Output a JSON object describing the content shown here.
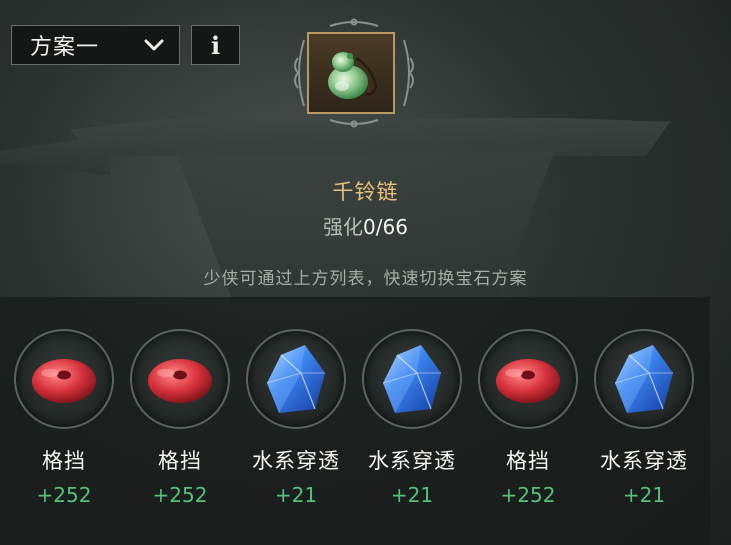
{
  "plan_selector": {
    "label": "方案一",
    "icon": "chevron-down-icon"
  },
  "info_button": {
    "label": "i",
    "icon": "info-icon"
  },
  "item": {
    "icon": "jade-pendant-icon",
    "name": "千铃链",
    "enhance_label": "强化",
    "enhance_value": "0/66"
  },
  "hint": "少侠可通过上方列表，快速切换宝石方案",
  "gems": [
    {
      "type": "red-disc",
      "name": "格挡",
      "value": "+252"
    },
    {
      "type": "red-disc",
      "name": "格挡",
      "value": "+252"
    },
    {
      "type": "blue-crystal",
      "name": "水系穿透",
      "value": "+21"
    },
    {
      "type": "blue-crystal",
      "name": "水系穿透",
      "value": "+21"
    },
    {
      "type": "red-disc",
      "name": "格挡",
      "value": "+252"
    },
    {
      "type": "blue-crystal",
      "name": "水系穿透",
      "value": "+21"
    }
  ],
  "colors": {
    "item_name": "#e8c27a",
    "stat_value": "#55c07a",
    "frame_gold": "#b59a64"
  }
}
